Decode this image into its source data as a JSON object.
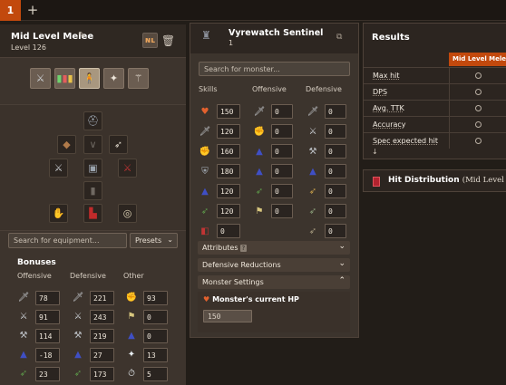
{
  "tabs": {
    "active": "1",
    "add": "+"
  },
  "loadout": {
    "name": "Mid Level Melee",
    "level": "Level 126",
    "modes": [
      "melee",
      "ranged-stats",
      "prayer",
      "magic",
      "special"
    ]
  },
  "equipment": {
    "search_placeholder": "Search for equipment...",
    "presets_label": "Presets"
  },
  "bonuses": {
    "title": "Bonuses",
    "columns": [
      "Offensive",
      "Defensive",
      "Other"
    ],
    "offensive": [
      "78",
      "91",
      "114",
      "-18",
      "23"
    ],
    "defensive": [
      "221",
      "243",
      "219",
      "27",
      "173"
    ],
    "other": [
      "93",
      "0",
      "0",
      "13",
      "5"
    ]
  },
  "monster": {
    "name": "Vyrewatch Sentinel",
    "number": "1",
    "search_placeholder": "Search for monster...",
    "columns": [
      "Skills",
      "Offensive",
      "Defensive"
    ],
    "skills": [
      "150",
      "120",
      "160",
      "180",
      "120",
      "120",
      "0"
    ],
    "offensive": [
      "0",
      "0",
      "0",
      "0",
      "0",
      "0"
    ],
    "defensive": [
      "0",
      "0",
      "0",
      "0",
      "0",
      "0",
      "0"
    ],
    "sections": [
      "Attributes",
      "Defensive Reductions",
      "Monster Settings"
    ],
    "hp_label": "Monster's current HP",
    "hp_value": "150"
  },
  "results": {
    "title": "Results",
    "column": "Mid Level Melee",
    "rows": [
      "Max hit",
      "DPS",
      "Avg. TTK",
      "Accuracy",
      "Spec expected hit"
    ],
    "expand": "↓"
  },
  "histogram": {
    "title": "Hit Distribution",
    "subtitle": "(Mid Level Me"
  },
  "colors": {
    "accent": "#c2490d",
    "panel": "#3d342d",
    "background": "#221d18"
  }
}
